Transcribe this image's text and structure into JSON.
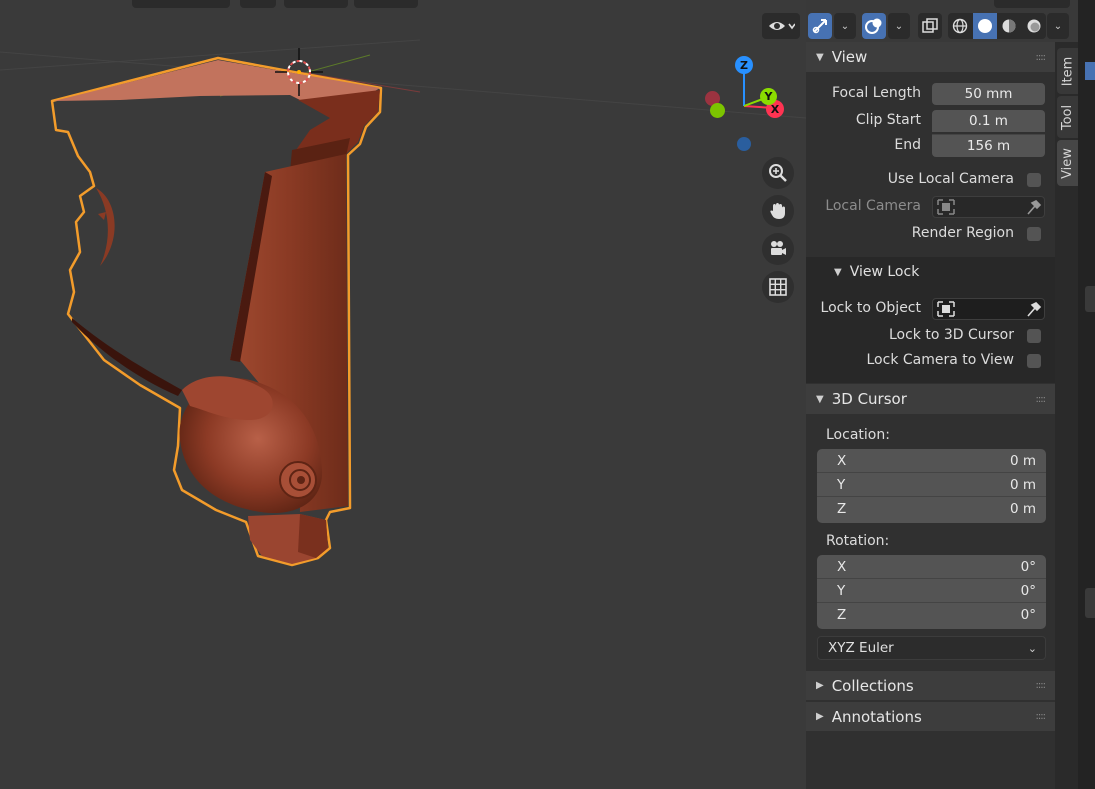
{
  "view_panel": {
    "title": "View",
    "focal_length_label": "Focal Length",
    "focal_length_value": "50 mm",
    "clip_start_label": "Clip Start",
    "clip_start_value": "0.1 m",
    "clip_end_label": "End",
    "clip_end_value": "156 m",
    "use_local_camera_label": "Use Local Camera",
    "local_camera_label": "Local Camera",
    "render_region_label": "Render Region"
  },
  "view_lock": {
    "title": "View Lock",
    "lock_to_object_label": "Lock to Object",
    "lock_to_3d_cursor_label": "Lock to 3D Cursor",
    "lock_camera_to_view_label": "Lock Camera to View"
  },
  "cursor_panel": {
    "title": "3D Cursor",
    "location_label": "Location:",
    "location": [
      {
        "axis": "X",
        "value": "0 m"
      },
      {
        "axis": "Y",
        "value": "0 m"
      },
      {
        "axis": "Z",
        "value": "0 m"
      }
    ],
    "rotation_label": "Rotation:",
    "rotation": [
      {
        "axis": "X",
        "value": "0°"
      },
      {
        "axis": "Y",
        "value": "0°"
      },
      {
        "axis": "Z",
        "value": "0°"
      }
    ],
    "rotation_mode": "XYZ Euler"
  },
  "collections_panel": {
    "title": "Collections"
  },
  "annotations_panel": {
    "title": "Annotations"
  },
  "sidebar_tabs": [
    "Item",
    "Tool",
    "View"
  ],
  "gizmo": {
    "x_label": "X",
    "y_label": "Y",
    "z_label": "Z"
  },
  "colors": {
    "viewport_bg": "#3a3a3a",
    "panel_bg": "#303030",
    "accent_blue": "#4772b3",
    "object_color": "#8e3b26",
    "selection_outline": "#f39c2b",
    "axis_x": "#ff3352",
    "axis_y": "#8bdc00",
    "axis_z": "#2890ff"
  },
  "icons": {
    "visibility": "eye-icon",
    "gizmo_toggle": "transform-gizmo-icon",
    "overlays": "overlays-icon",
    "xray": "xray-icon",
    "shading": [
      "wireframe-shading-icon",
      "solid-shading-icon",
      "material-shading-icon",
      "rendered-shading-icon"
    ],
    "navigation": [
      "zoom-icon",
      "pan-hand-icon",
      "camera-icon",
      "ortho-grid-icon"
    ]
  }
}
